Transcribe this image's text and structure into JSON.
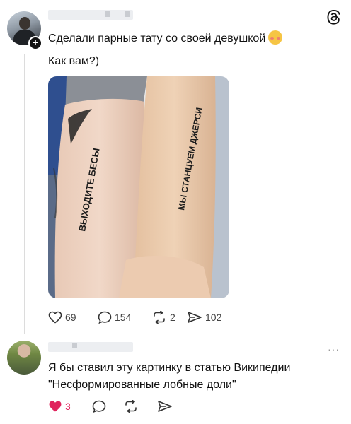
{
  "post": {
    "line1": "Сделали парные тату со своей девушкой",
    "emoji": "smiling-face-with-hearts-emoji",
    "line2": "Как вам?)",
    "photo": {
      "left_arm_text": "ВЫХОДИТЕ БЕСЫ",
      "right_arm_text": "МЫ СТАНЦУЕМ ДЖЕРСИ"
    },
    "actions": {
      "likes": "69",
      "replies": "154",
      "reposts": "2",
      "shares": "102"
    }
  },
  "comment": {
    "line1": "Я бы ставил эту картинку в статью Википедии",
    "line2": "\"Несформированные лобные доли\"",
    "actions": {
      "likes": "3"
    },
    "more": "···"
  },
  "colors": {
    "like_active": "#e0245e",
    "icon": "#333333",
    "thread_line": "#dcdcdc"
  }
}
